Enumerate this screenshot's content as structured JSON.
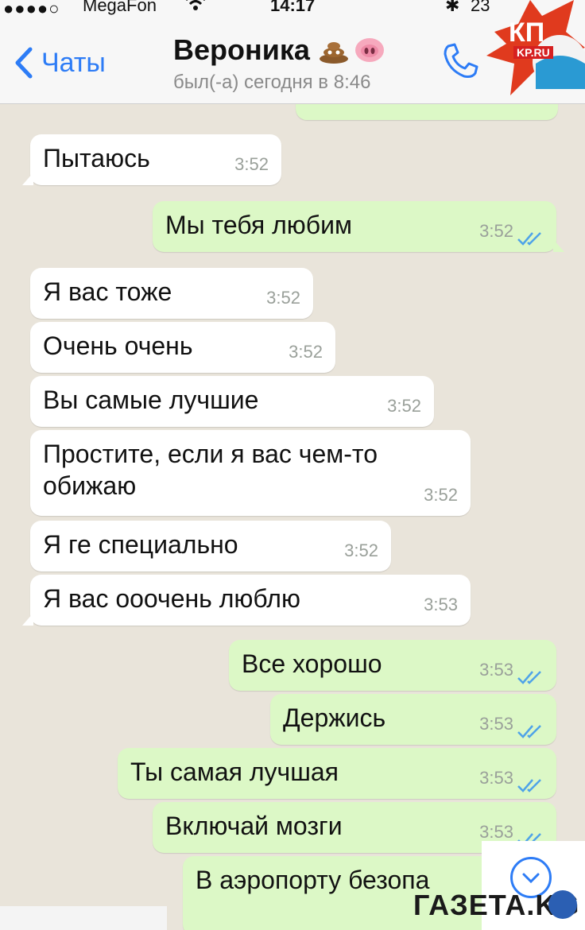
{
  "status_bar": {
    "signal": "●●●●○",
    "carrier": "MegaFon",
    "time": "14:17",
    "battery": "23"
  },
  "header": {
    "back_label": "Чаты",
    "contact_name": "Вероника",
    "emojis": [
      "poop-emoji",
      "pig-nose-emoji"
    ],
    "last_seen": "был(-а) сегодня в 8:46",
    "accent": "#2d7cf6"
  },
  "watermarks": {
    "kp": "КП",
    "kp_site": "KP.RU",
    "gazeta": "ГАЗЕТА.KG"
  },
  "messages": [
    {
      "dir": "in",
      "text": "Пытаюсь",
      "time": "3:52"
    },
    {
      "dir": "out",
      "text": "Мы тебя любим",
      "time": "3:52"
    },
    {
      "dir": "in",
      "text": "Я вас тоже",
      "time": "3:52"
    },
    {
      "dir": "in",
      "text": "Очень очень",
      "time": "3:52"
    },
    {
      "dir": "in",
      "text": "Вы самые лучшие",
      "time": "3:52"
    },
    {
      "dir": "in",
      "text": "Простите, если я вас чем-то обижаю",
      "time": "3:52"
    },
    {
      "dir": "in",
      "text": "Я ге специально",
      "time": "3:52"
    },
    {
      "dir": "in",
      "text": "Я вас ооочень люблю",
      "time": "3:53"
    },
    {
      "dir": "out",
      "text": "Все хорошо",
      "time": "3:53"
    },
    {
      "dir": "out",
      "text": "Держись",
      "time": "3:53"
    },
    {
      "dir": "out",
      "text": "Ты самая лучшая",
      "time": "3:53"
    },
    {
      "dir": "out",
      "text": "Включай мозги",
      "time": "3:53"
    },
    {
      "dir": "out",
      "text": "В аэропорту безопа",
      "time": ""
    }
  ],
  "colors": {
    "incoming_bubble": "#ffffff",
    "outgoing_bubble": "#dcf8c6",
    "read_ticks": "#4fa3e8"
  }
}
